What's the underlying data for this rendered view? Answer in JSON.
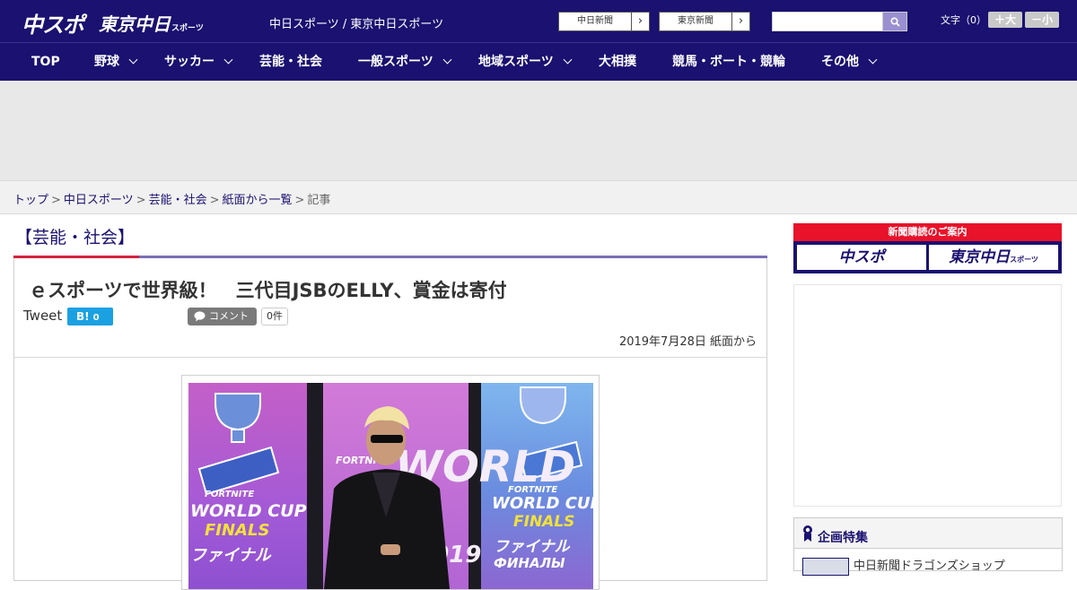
{
  "header": {
    "logo_chuspo": "中スポ",
    "logo_tokyo": "東京中日",
    "logo_tokyo_sub": "スポーツ",
    "site_names": "中日スポーツ / 東京中日スポーツ",
    "links": [
      {
        "label": "中日新聞",
        "arrow": "›"
      },
      {
        "label": "東京新聞",
        "arrow": "›"
      }
    ],
    "search": {
      "placeholder": ""
    },
    "font_size_label": "文字（0）",
    "font_larger": "＋大",
    "font_smaller": "－小"
  },
  "nav": {
    "items": [
      {
        "label": "TOP"
      },
      {
        "label": "野球"
      },
      {
        "label": "サッカー"
      },
      {
        "label": "芸能・社会"
      },
      {
        "label": "一般スポーツ"
      },
      {
        "label": "地域スポーツ"
      },
      {
        "label": "大相撲"
      },
      {
        "label": "競馬・ボート・競輪"
      },
      {
        "label": "その他"
      }
    ]
  },
  "breadcrumb": {
    "items": [
      "トップ",
      "中日スポーツ",
      "芸能・社会",
      "紙面から一覧"
    ],
    "current": "記事",
    "separator": ">"
  },
  "category_heading": "【芸能・社会】",
  "article": {
    "title": "ｅスポーツで世界級！　三代目JSBのELLY、賞金は寄付",
    "tweet_label": "Tweet",
    "hatena_label": "B!",
    "hatena_count": "0",
    "comment_label": "コメント",
    "comment_count": "0件",
    "date": "2019年7月28日 紙面から",
    "photo_text": {
      "fortnite": "FORTNITE",
      "world_cup": "WORLD CUP",
      "finals": "FINALS",
      "finals_ja": "ファイナル",
      "year": "2019",
      "finals_ru": "ФИНАЛЫ"
    }
  },
  "sidebar": {
    "banner_title": "新聞購読のご案内",
    "banner_left": "中スポ",
    "banner_right": "東京中日",
    "banner_right_sub": "スポーツ",
    "feature_title": "企画特集",
    "feature_item": "中日新聞ドラゴンズショップ"
  },
  "colors": {
    "brand_navy": "#1a1170",
    "accent_red": "#d3233e",
    "hatena_blue": "#1ba1e2"
  }
}
